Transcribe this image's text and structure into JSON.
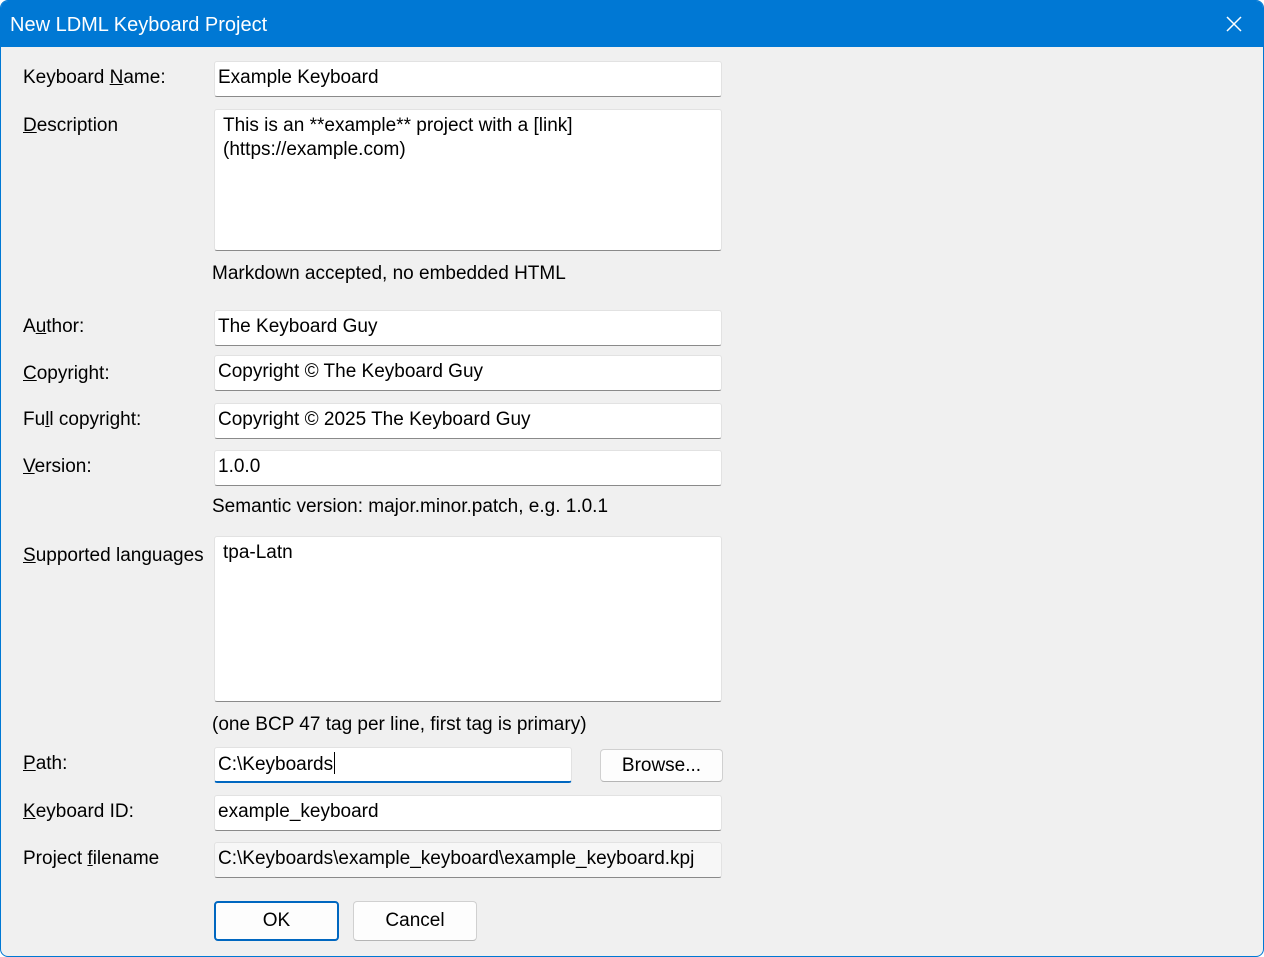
{
  "window": {
    "title": "New LDML Keyboard Project",
    "close_icon": "close-icon"
  },
  "form": {
    "keyboard_name": {
      "label_pre": "Keyboard ",
      "label_key": "N",
      "label_post": "ame:",
      "value": "Example Keyboard"
    },
    "description": {
      "label_pre": "",
      "label_key": "D",
      "label_post": "escription",
      "value": "This is an **example** project with a [link]\n(https://example.com)",
      "hint": "Markdown accepted, no embedded HTML"
    },
    "author": {
      "label_pre": "A",
      "label_key": "u",
      "label_post": "thor:",
      "value": "The Keyboard Guy"
    },
    "copyright": {
      "label_pre": "",
      "label_key": "C",
      "label_post": "opyright:",
      "value": "Copyright © The Keyboard Guy"
    },
    "full_copyright": {
      "label_pre": "Fu",
      "label_key": "l",
      "label_post": "l copyright:",
      "value": "Copyright © 2025 The Keyboard Guy"
    },
    "version": {
      "label_pre": "",
      "label_key": "V",
      "label_post": "ersion:",
      "value": "1.0.0",
      "hint": "Semantic version: major.minor.patch, e.g. 1.0.1"
    },
    "supported_languages": {
      "label_pre": "",
      "label_key": "S",
      "label_post": "upported languages",
      "value": "tpa-Latn",
      "hint": "(one BCP 47 tag per line, first tag is primary)"
    },
    "path": {
      "label_pre": "",
      "label_key": "P",
      "label_post": "ath:",
      "value": "C:\\Keyboards",
      "browse_label": "Browse..."
    },
    "keyboard_id": {
      "label_pre": "",
      "label_key": "K",
      "label_post": "eyboard ID:",
      "value": "example_keyboard"
    },
    "project_filename": {
      "label_pre": "Project ",
      "label_key": "f",
      "label_post": "ilename",
      "value": "C:\\Keyboards\\example_keyboard\\example_keyboard.kpj"
    }
  },
  "buttons": {
    "ok": "OK",
    "cancel": "Cancel"
  },
  "colors": {
    "accent": "#0078d4",
    "focus": "#0067c0",
    "background": "#f0f0f0"
  }
}
